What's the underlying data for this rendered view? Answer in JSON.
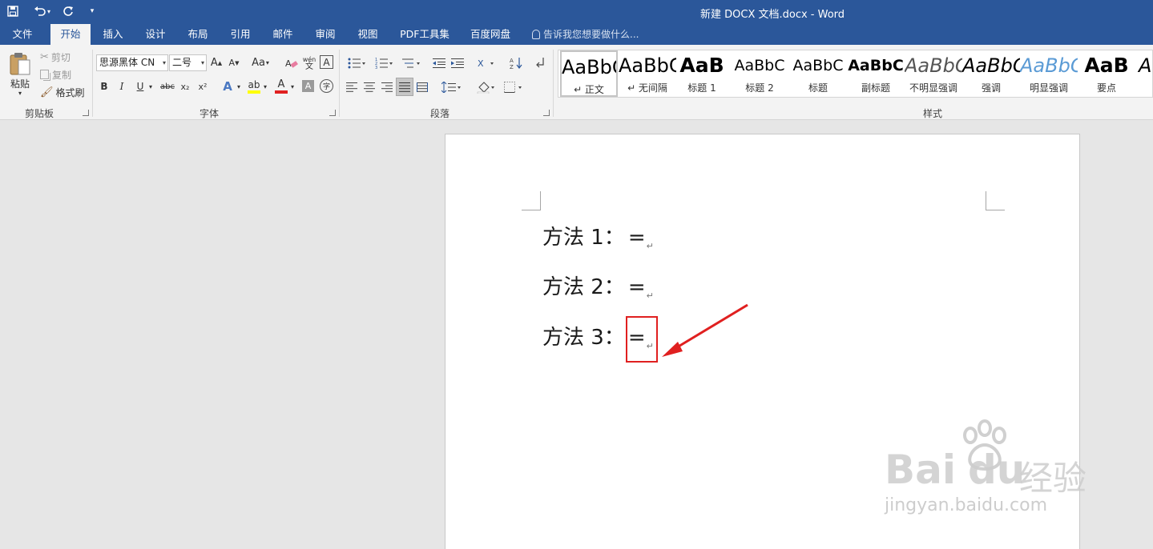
{
  "title_bar": {
    "document_title": "新建 DOCX 文档.docx - Word",
    "quick_access": [
      "save-icon",
      "undo-icon",
      "redo-icon",
      "customize-icon"
    ]
  },
  "tabs": [
    "文件",
    "开始",
    "插入",
    "设计",
    "布局",
    "引用",
    "邮件",
    "审阅",
    "视图",
    "PDF工具集",
    "百度网盘"
  ],
  "active_tab": "开始",
  "tell_me": "告诉我您想要做什么...",
  "clipboard": {
    "paste_label": "粘贴",
    "cut_label": "剪切",
    "copy_label": "复制",
    "format_painter_label": "格式刷",
    "group_label": "剪贴板"
  },
  "font": {
    "font_name": "思源黑体 CN",
    "font_size": "二号",
    "group_label": "字体",
    "bold": "B",
    "italic": "I",
    "underline": "U",
    "strike": "abc",
    "subscript": "x₂",
    "superscript": "x²",
    "change_case": "Aa",
    "grow": "A",
    "shrink": "A",
    "phonetic": "wén",
    "phonetic_char": "文",
    "border_char": "A",
    "font_color": "A",
    "shade_char": "A",
    "enclose_char": "字"
  },
  "paragraph": {
    "group_label": "段落"
  },
  "styles": {
    "group_label": "样式",
    "items": [
      {
        "sample": "AaBbCcDd",
        "label": "↵ 正文"
      },
      {
        "sample": "AaBbCcDd",
        "label": "↵ 无间隔"
      },
      {
        "sample": "AaB",
        "label": "标题 1"
      },
      {
        "sample": "AaBbC",
        "label": "标题 2"
      },
      {
        "sample": "AaBbC",
        "label": "标题"
      },
      {
        "sample": "AaBbC",
        "label": "副标题"
      },
      {
        "sample": "AaBbCcDd",
        "label": "不明显强调"
      },
      {
        "sample": "AaBbCcDd",
        "label": "强调"
      },
      {
        "sample": "AaBbCcDd",
        "label": "明显强调"
      },
      {
        "sample": "AaB",
        "label": "要点"
      },
      {
        "sample": "AaBbCcDd",
        "label": ""
      }
    ]
  },
  "document": {
    "lines": [
      {
        "label": "方法 1：",
        "formula": "="
      },
      {
        "label": "方法 2：",
        "formula": "="
      },
      {
        "label": "方法 3：",
        "formula": "="
      }
    ],
    "paragraph_mark": "↵"
  },
  "watermark": {
    "brand_left": "Bai",
    "brand_right": "du",
    "brand_cn": "经验",
    "url": "jingyan.baidu.com"
  },
  "colors": {
    "title_bar": "#2b579a",
    "annotation": "#e02020",
    "font_color_bar": "#e02020",
    "highlight_bar": "#ffff00"
  }
}
